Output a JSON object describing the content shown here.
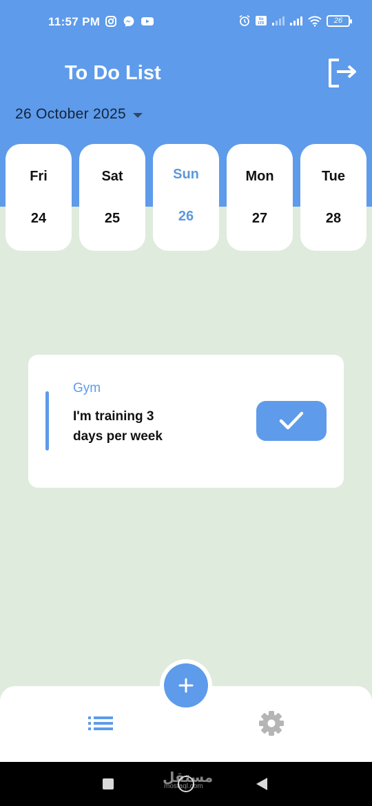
{
  "status_bar": {
    "time": "11:57 PM",
    "battery": "26",
    "icons": [
      "instagram-icon",
      "messenger-icon",
      "youtube-icon",
      "alarm-icon",
      "volte-icon",
      "signal-icon",
      "wifi-icon",
      "battery-icon"
    ]
  },
  "header": {
    "title": "To Do List",
    "selected_date": "26 October 2025"
  },
  "days": [
    {
      "name": "Fri",
      "num": "24",
      "selected": false
    },
    {
      "name": "Sat",
      "num": "25",
      "selected": false
    },
    {
      "name": "Sun",
      "num": "26",
      "selected": true
    },
    {
      "name": "Mon",
      "num": "27",
      "selected": false
    },
    {
      "name": "Tue",
      "num": "28",
      "selected": false
    }
  ],
  "task": {
    "category": "Gym",
    "text": "I'm training 3 days per week",
    "done": false
  },
  "nav": {
    "fab_icon": "plus-icon",
    "items": [
      "list-icon",
      "gear-icon"
    ]
  },
  "watermark": {
    "text": "مستقل",
    "sub": "mostaql.com"
  },
  "colors": {
    "primary": "#5e9bea",
    "background": "#dfebdc",
    "card": "#ffffff",
    "text": "#111111",
    "inactive_icon": "#b5b5b5"
  }
}
